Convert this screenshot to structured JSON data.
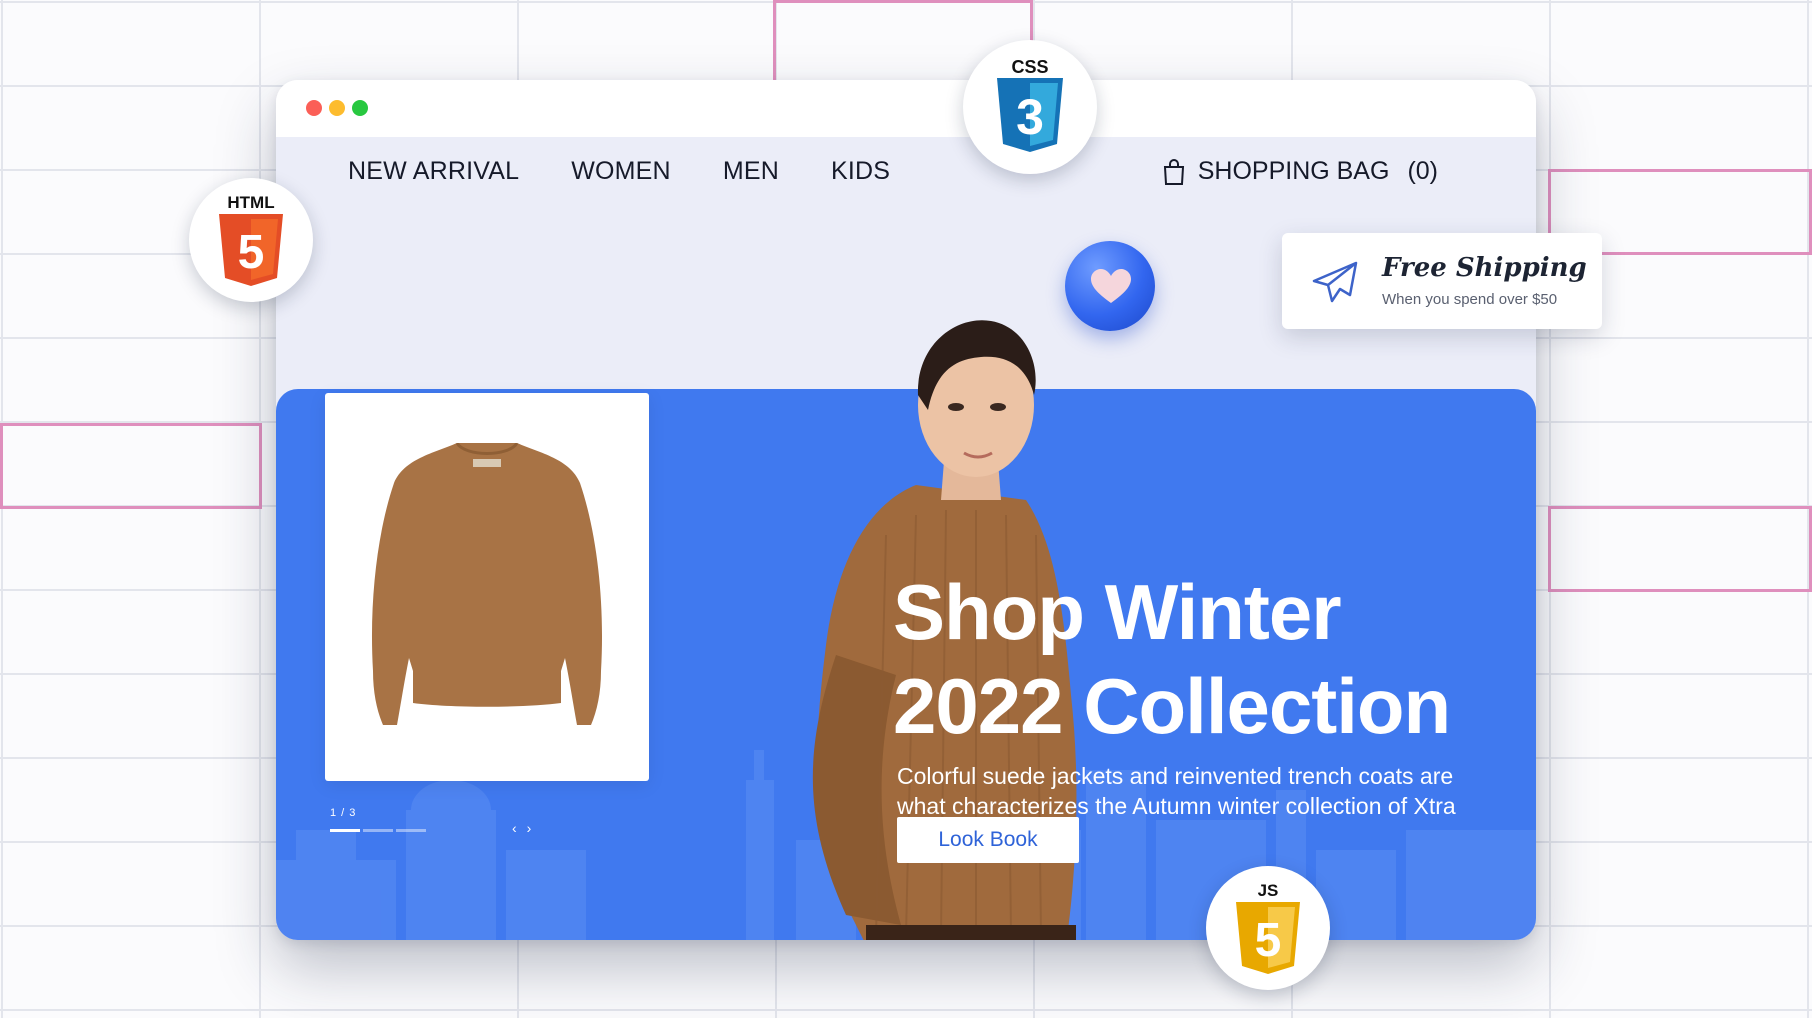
{
  "window": {
    "controls": [
      "close",
      "minimize",
      "maximize"
    ]
  },
  "nav": {
    "items": [
      {
        "label": "NEW ARRIVAL"
      },
      {
        "label": "WOMEN"
      },
      {
        "label": "MEN"
      },
      {
        "label": "KIDS"
      }
    ],
    "bag_label": "SHOPPING BAG",
    "bag_count": "(0)",
    "bag_icon": "shopping-bag-icon"
  },
  "carousel": {
    "counter": "1 / 3",
    "current_slide": 1,
    "total_slides": 3,
    "prev_label": "‹",
    "next_label": "›"
  },
  "hero": {
    "headline_line1": "Shop Winter",
    "headline_line2": "2022 Collection",
    "description": "Colorful suede jackets and reinvented trench coats are what characterizes the Autumn winter collection of Xtra Fashion.",
    "button_label": "Look Book",
    "background_color": "#4079ef"
  },
  "shipping": {
    "title": "Free Shipping",
    "subtitle": "When you spend over $50",
    "icon": "plane-icon"
  },
  "badges": {
    "html": "HTML",
    "css": "CSS",
    "js": "JS"
  },
  "colors": {
    "accent": "#4079ef",
    "page_bg": "#ebedf8",
    "html_orange": "#e44d26",
    "css_blue": "#1572b6",
    "js_yellow": "#f0c030"
  }
}
